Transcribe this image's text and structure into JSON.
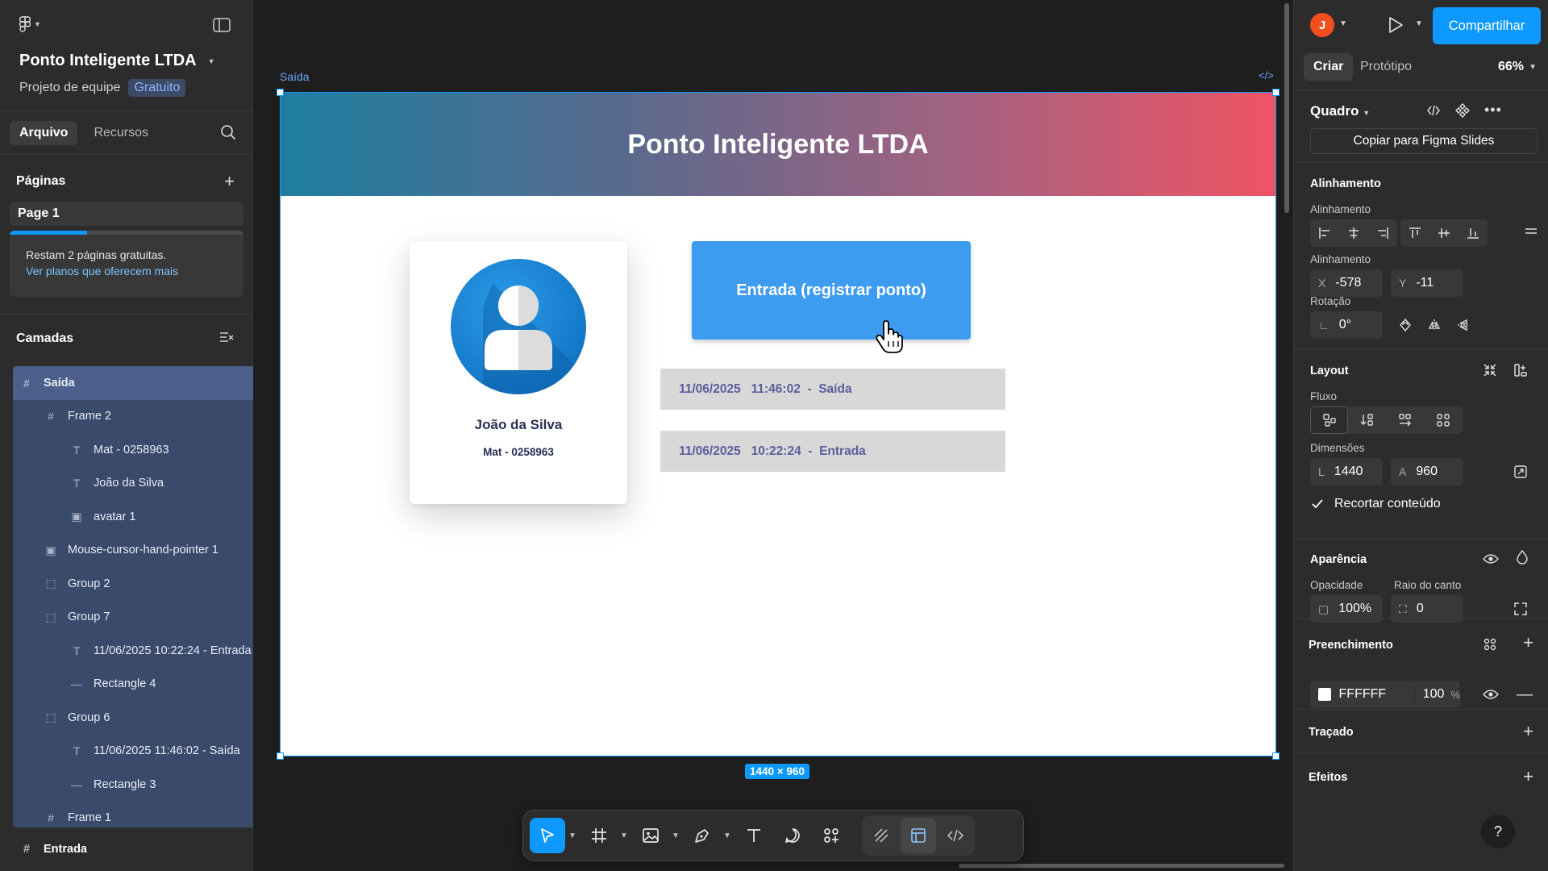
{
  "file": {
    "title": "Ponto Inteligente LTDA",
    "team": "Projeto de equipe",
    "plan": "Gratuito"
  },
  "left_tabs": [
    "Arquivo",
    "Recursos"
  ],
  "pages": {
    "title": "Páginas",
    "items": [
      "Page 1"
    ],
    "notice": "Restam 2 páginas gratuitas.",
    "notice_link": "Ver planos que oferecem mais",
    "progress": 0.33
  },
  "layers": {
    "title": "Camadas",
    "items": [
      {
        "label": "Saída",
        "icon": "frame-icon",
        "depth": 0,
        "selected": true
      },
      {
        "label": "Frame 2",
        "icon": "frame-icon",
        "depth": 1
      },
      {
        "label": "Mat - 0258963",
        "icon": "text-icon",
        "depth": 2
      },
      {
        "label": "João da Silva",
        "icon": "text-icon",
        "depth": 2
      },
      {
        "label": "avatar 1",
        "icon": "image-icon",
        "depth": 2
      },
      {
        "label": "Mouse-cursor-hand-pointer 1",
        "icon": "image-icon",
        "depth": 1
      },
      {
        "label": "Group 2",
        "icon": "group-icon",
        "depth": 1
      },
      {
        "label": "Group 7",
        "icon": "group-icon",
        "depth": 1
      },
      {
        "label": "11/06/2025 10:22:24 - Entrada",
        "icon": "text-icon",
        "depth": 2
      },
      {
        "label": "Rectangle 4",
        "icon": "line-icon",
        "depth": 2
      },
      {
        "label": "Group 6",
        "icon": "group-icon",
        "depth": 1
      },
      {
        "label": "11/06/2025 11:46:02 - Saída",
        "icon": "text-icon",
        "depth": 2
      },
      {
        "label": "Rectangle 3",
        "icon": "line-icon",
        "depth": 2
      },
      {
        "label": "Frame 1",
        "icon": "frame-icon",
        "depth": 1
      }
    ],
    "bottom": "Entrada"
  },
  "canvas": {
    "frame_label": "Saída",
    "header_title": "Ponto Inteligente LTDA",
    "user_name": "João da Silva",
    "user_mat": "Mat - 0258963",
    "entry_button": "Entrada (registrar ponto)",
    "logs": [
      "11/06/2025   11:46:02  -  Saída",
      "11/06/2025   10:22:24  -  Entrada"
    ],
    "dimensions": "1440 × 960",
    "header_gradient": [
      "#1e7ea0",
      "#ef5464"
    ],
    "button_color": "#3e9cf0"
  },
  "toolbar": [
    "move-tool",
    "frame-tool",
    "image-tool",
    "pen-tool",
    "text-tool",
    "comment-tool",
    "components-tool",
    "draw-mode",
    "design-mode",
    "dev-mode"
  ],
  "right": {
    "user_initial": "J",
    "share": "Compartilhar",
    "tabs": [
      "Criar",
      "Protótipo"
    ],
    "zoom": "66%",
    "frame_type": "Quadro",
    "copy_slides": "Copiar para Figma Slides",
    "alignment_title": "Alinhamento",
    "alignment_sub": "Alinhamento",
    "position_sub": "Alinhamento",
    "x_label": "X",
    "x": "-578",
    "y_label": "Y",
    "y": "-11",
    "rotation_label": "Rotação",
    "rotation": "0°",
    "layout_title": "Layout",
    "flow_label": "Fluxo",
    "dims_label": "Dimensões",
    "w_label": "L",
    "w": "1440",
    "h_label": "A",
    "h": "960",
    "clip": "Recortar conteúdo",
    "appearance_title": "Aparência",
    "opacity_label": "Opacidade",
    "opacity": "100%",
    "radius_label": "Raio do canto",
    "radius": "0",
    "fill_title": "Preenchimento",
    "fill_hex": "FFFFFF",
    "fill_opacity": "100",
    "fill_unit": "%",
    "stroke_title": "Traçado",
    "effects_title": "Efeitos",
    "help": "?"
  },
  "colors": {
    "accent": "#0d99ff",
    "selection_layers": "#3a4a6b",
    "user_avatar": "#f24e1e"
  }
}
